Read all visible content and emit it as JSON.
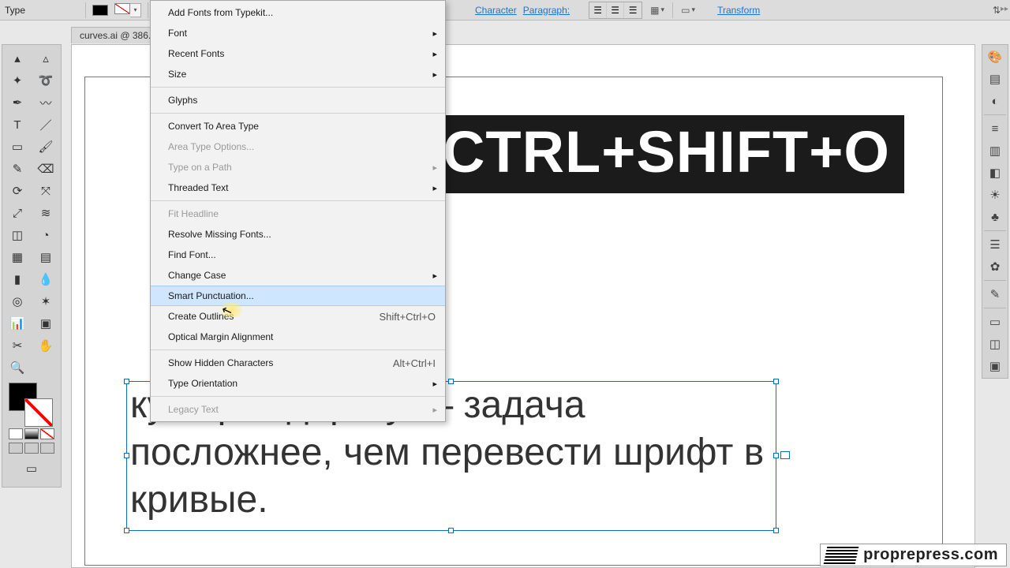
{
  "topbar": {
    "type_label": "Type",
    "character_link": "Character",
    "paragraph_link": "Paragraph:",
    "transform_link": "Transform"
  },
  "tab": {
    "label": "curves.ai @ 386..."
  },
  "canvas": {
    "headline": "CTRL+SHIFT+O",
    "area_text": "ку через дорогу — задача посложнее, чем перевести шрифт в кривые."
  },
  "type_menu": {
    "items": [
      {
        "label": "Add Fonts from Typekit...",
        "disabled": false,
        "submenu": false
      },
      {
        "label": "Font",
        "disabled": false,
        "submenu": true
      },
      {
        "label": "Recent Fonts",
        "disabled": false,
        "submenu": true
      },
      {
        "label": "Size",
        "disabled": false,
        "submenu": true
      },
      null,
      {
        "label": "Glyphs",
        "disabled": false,
        "submenu": false
      },
      null,
      {
        "label": "Convert To Area Type",
        "disabled": false,
        "submenu": false
      },
      {
        "label": "Area Type Options...",
        "disabled": true,
        "submenu": false
      },
      {
        "label": "Type on a Path",
        "disabled": true,
        "submenu": true
      },
      {
        "label": "Threaded Text",
        "disabled": false,
        "submenu": true
      },
      null,
      {
        "label": "Fit Headline",
        "disabled": true,
        "submenu": false
      },
      {
        "label": "Resolve Missing Fonts...",
        "disabled": false,
        "submenu": false
      },
      {
        "label": "Find Font...",
        "disabled": false,
        "submenu": false
      },
      {
        "label": "Change Case",
        "disabled": false,
        "submenu": true
      },
      {
        "label": "Smart Punctuation...",
        "disabled": false,
        "submenu": false,
        "highlight": true
      },
      {
        "label": "Create Outlines",
        "disabled": false,
        "submenu": false,
        "shortcut": "Shift+Ctrl+O"
      },
      {
        "label": "Optical Margin Alignment",
        "disabled": false,
        "submenu": false
      },
      null,
      {
        "label": "Show Hidden Characters",
        "disabled": false,
        "submenu": false,
        "shortcut": "Alt+Ctrl+I"
      },
      {
        "label": "Type Orientation",
        "disabled": false,
        "submenu": true
      },
      null,
      {
        "label": "Legacy Text",
        "disabled": true,
        "submenu": true
      }
    ]
  },
  "watermark": {
    "label": "proprepress.com"
  }
}
